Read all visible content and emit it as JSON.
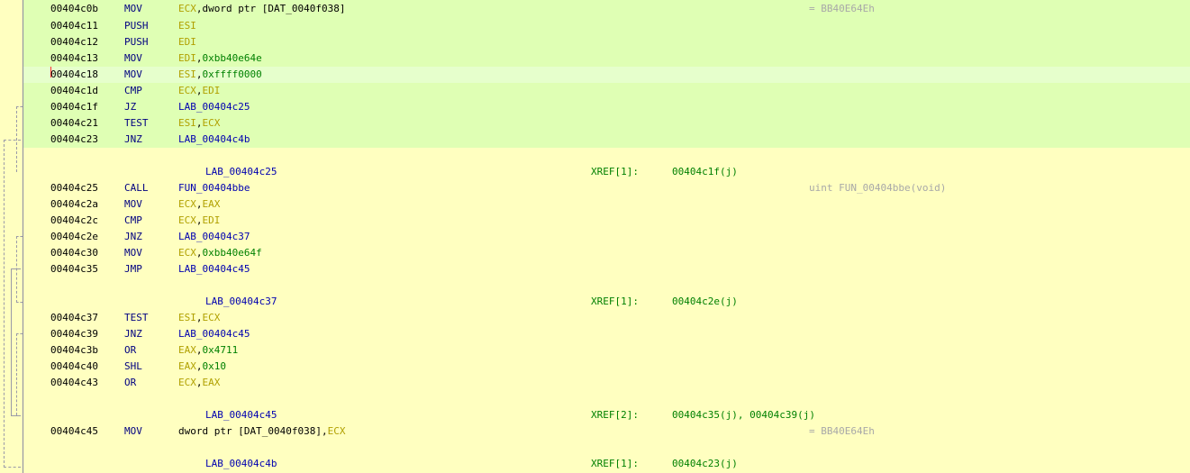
{
  "rows": [
    {
      "kind": "insn",
      "addr": "00404c0b",
      "mn": "MOV",
      "ops": [
        {
          "t": "ECX",
          "c": "reg"
        },
        {
          "t": ",dword ptr [DAT_0040f038]",
          "c": "plain"
        }
      ],
      "comment": "= BB40E64Eh",
      "bg": "sel"
    },
    {
      "kind": "insn",
      "addr": "00404c11",
      "mn": "PUSH",
      "ops": [
        {
          "t": "ESI",
          "c": "reg"
        }
      ],
      "bg": "sel"
    },
    {
      "kind": "insn",
      "addr": "00404c12",
      "mn": "PUSH",
      "ops": [
        {
          "t": "EDI",
          "c": "reg"
        }
      ],
      "bg": "sel"
    },
    {
      "kind": "insn",
      "addr": "00404c13",
      "mn": "MOV",
      "ops": [
        {
          "t": "EDI",
          "c": "reg"
        },
        {
          "t": ",",
          "c": "plain"
        },
        {
          "t": "0xbb40e64e",
          "c": "sc"
        }
      ],
      "bg": "sel"
    },
    {
      "kind": "insn",
      "addr": "00404c18",
      "mn": "MOV",
      "ops": [
        {
          "t": "ESI",
          "c": "reg"
        },
        {
          "t": ",",
          "c": "plain"
        },
        {
          "t": "0xffff0000",
          "c": "sc"
        }
      ],
      "bg": "cur",
      "cursor": true
    },
    {
      "kind": "insn",
      "addr": "00404c1d",
      "mn": "CMP",
      "ops": [
        {
          "t": "ECX",
          "c": "reg"
        },
        {
          "t": ",",
          "c": "plain"
        },
        {
          "t": "EDI",
          "c": "reg"
        }
      ],
      "bg": "sel"
    },
    {
      "kind": "insn",
      "addr": "00404c1f",
      "mn": "JZ",
      "ops": [
        {
          "t": "LAB_00404c25",
          "c": "lbl"
        }
      ],
      "bg": "sel"
    },
    {
      "kind": "insn",
      "addr": "00404c21",
      "mn": "TEST",
      "ops": [
        {
          "t": "ESI",
          "c": "reg"
        },
        {
          "t": ",",
          "c": "plain"
        },
        {
          "t": "ECX",
          "c": "reg"
        }
      ],
      "bg": "sel"
    },
    {
      "kind": "insn",
      "addr": "00404c23",
      "mn": "JNZ",
      "ops": [
        {
          "t": "LAB_00404c4b",
          "c": "lbl"
        }
      ],
      "bg": "sel"
    },
    {
      "kind": "blank"
    },
    {
      "kind": "label",
      "label": "LAB_00404c25",
      "xref_label": "XREF[1]:",
      "xref_addrs": "00404c1f(j)"
    },
    {
      "kind": "insn",
      "addr": "00404c25",
      "mn": "CALL",
      "ops": [
        {
          "t": "FUN_00404bbe",
          "c": "lbl"
        }
      ],
      "comment": "uint FUN_00404bbe(void)"
    },
    {
      "kind": "insn",
      "addr": "00404c2a",
      "mn": "MOV",
      "ops": [
        {
          "t": "ECX",
          "c": "reg"
        },
        {
          "t": ",",
          "c": "plain"
        },
        {
          "t": "EAX",
          "c": "reg"
        }
      ]
    },
    {
      "kind": "insn",
      "addr": "00404c2c",
      "mn": "CMP",
      "ops": [
        {
          "t": "ECX",
          "c": "reg"
        },
        {
          "t": ",",
          "c": "plain"
        },
        {
          "t": "EDI",
          "c": "reg"
        }
      ]
    },
    {
      "kind": "insn",
      "addr": "00404c2e",
      "mn": "JNZ",
      "ops": [
        {
          "t": "LAB_00404c37",
          "c": "lbl"
        }
      ]
    },
    {
      "kind": "insn",
      "addr": "00404c30",
      "mn": "MOV",
      "ops": [
        {
          "t": "ECX",
          "c": "reg"
        },
        {
          "t": ",",
          "c": "plain"
        },
        {
          "t": "0xbb40e64f",
          "c": "sc"
        }
      ]
    },
    {
      "kind": "insn",
      "addr": "00404c35",
      "mn": "JMP",
      "ops": [
        {
          "t": "LAB_00404c45",
          "c": "lbl"
        }
      ]
    },
    {
      "kind": "blank"
    },
    {
      "kind": "label",
      "label": "LAB_00404c37",
      "xref_label": "XREF[1]:",
      "xref_addrs": "00404c2e(j)"
    },
    {
      "kind": "insn",
      "addr": "00404c37",
      "mn": "TEST",
      "ops": [
        {
          "t": "ESI",
          "c": "reg"
        },
        {
          "t": ",",
          "c": "plain"
        },
        {
          "t": "ECX",
          "c": "reg"
        }
      ]
    },
    {
      "kind": "insn",
      "addr": "00404c39",
      "mn": "JNZ",
      "ops": [
        {
          "t": "LAB_00404c45",
          "c": "lbl"
        }
      ]
    },
    {
      "kind": "insn",
      "addr": "00404c3b",
      "mn": "OR",
      "ops": [
        {
          "t": "EAX",
          "c": "reg"
        },
        {
          "t": ",",
          "c": "plain"
        },
        {
          "t": "0x4711",
          "c": "sc"
        }
      ]
    },
    {
      "kind": "insn",
      "addr": "00404c40",
      "mn": "SHL",
      "ops": [
        {
          "t": "EAX",
          "c": "reg"
        },
        {
          "t": ",",
          "c": "plain"
        },
        {
          "t": "0x10",
          "c": "sc"
        }
      ]
    },
    {
      "kind": "insn",
      "addr": "00404c43",
      "mn": "OR",
      "ops": [
        {
          "t": "ECX",
          "c": "reg"
        },
        {
          "t": ",",
          "c": "plain"
        },
        {
          "t": "EAX",
          "c": "reg"
        }
      ]
    },
    {
      "kind": "blank"
    },
    {
      "kind": "label",
      "label": "LAB_00404c45",
      "xref_label": "XREF[2]:",
      "xref_addrs": "00404c35(j), 00404c39(j)"
    },
    {
      "kind": "insn",
      "addr": "00404c45",
      "mn": "MOV",
      "ops": [
        {
          "t": "dword ptr [DAT_0040f038]",
          "c": "plain"
        },
        {
          "t": ",",
          "c": "plain"
        },
        {
          "t": "ECX",
          "c": "reg"
        }
      ],
      "comment": "= BB40E64Eh"
    },
    {
      "kind": "blank"
    },
    {
      "kind": "label",
      "label": "LAB_00404c4b",
      "xref_label": "XREF[1]:",
      "xref_addrs": "00404c23(j)"
    }
  ]
}
